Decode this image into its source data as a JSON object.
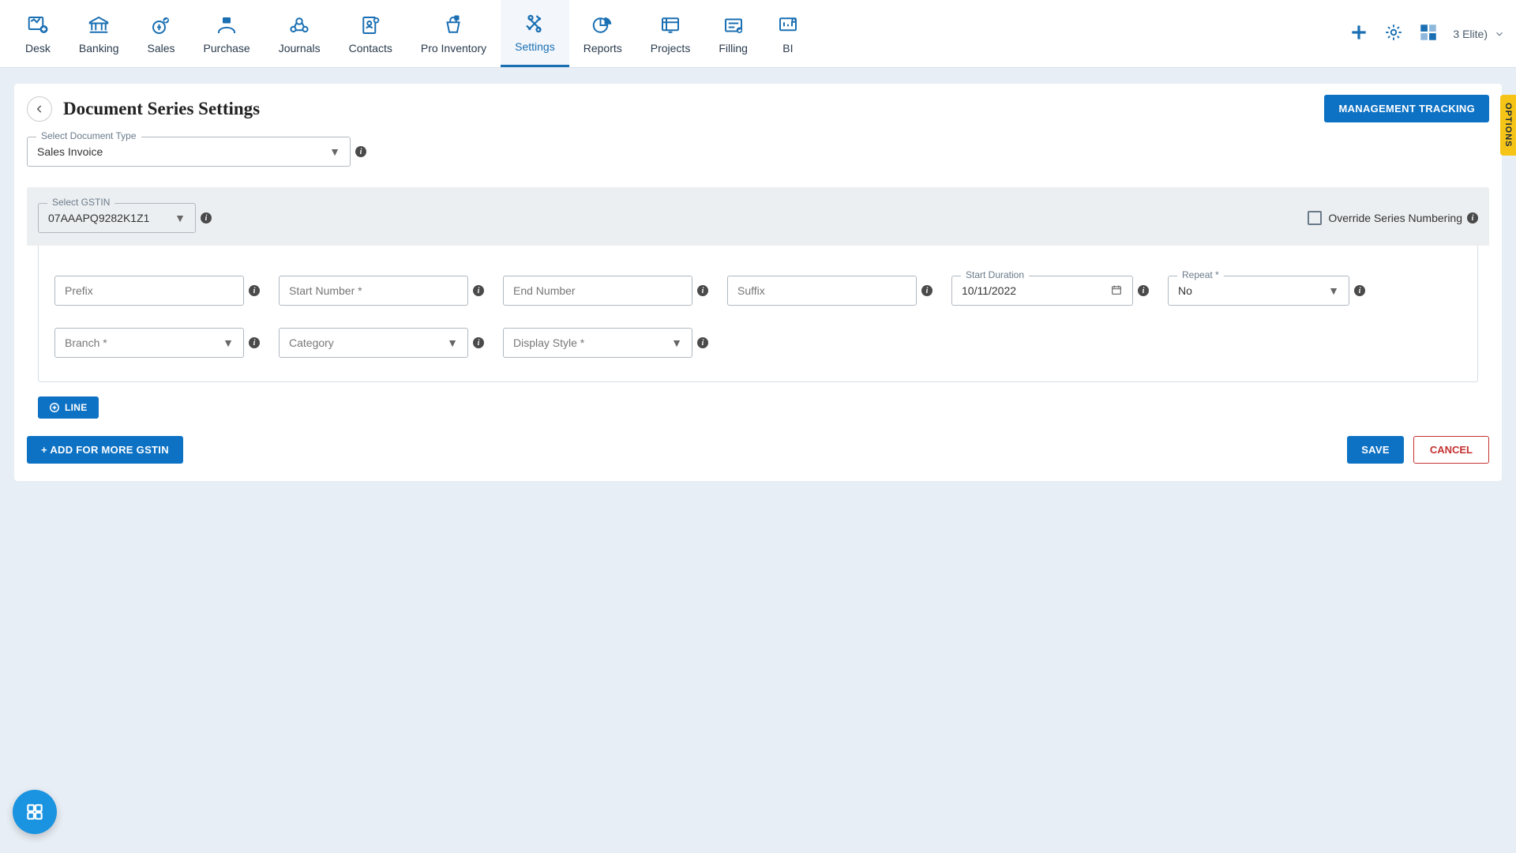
{
  "nav": {
    "items": [
      {
        "label": "Desk"
      },
      {
        "label": "Banking"
      },
      {
        "label": "Sales"
      },
      {
        "label": "Purchase"
      },
      {
        "label": "Journals"
      },
      {
        "label": "Contacts"
      },
      {
        "label": "Pro Inventory"
      },
      {
        "label": "Settings"
      },
      {
        "label": "Reports"
      },
      {
        "label": "Projects"
      },
      {
        "label": "Filling"
      },
      {
        "label": "BI"
      }
    ],
    "user_label": "3 Elite)"
  },
  "page": {
    "title": "Document Series Settings",
    "management_btn": "MANAGEMENT TRACKING",
    "options_tab": "OPTIONS"
  },
  "doc_type": {
    "label": "Select Document Type",
    "value": "Sales Invoice"
  },
  "gstin": {
    "label": "Select GSTIN",
    "value": "07AAAPQ9282K1Z1",
    "override_label": "Override Series Numbering"
  },
  "fields": {
    "prefix": {
      "label": "Prefix"
    },
    "start_number": {
      "label": "Start Number *"
    },
    "end_number": {
      "label": "End Number"
    },
    "suffix": {
      "label": "Suffix"
    },
    "start_duration": {
      "label": "Start Duration",
      "value": "10/11/2022"
    },
    "repeat": {
      "label": "Repeat *",
      "value": "No"
    },
    "branch": {
      "label": "Branch *"
    },
    "category": {
      "label": "Category"
    },
    "display_style": {
      "label": "Display Style *"
    }
  },
  "buttons": {
    "line": "LINE",
    "add_gstin": "+ ADD FOR MORE GSTIN",
    "save": "SAVE",
    "cancel": "CANCEL"
  }
}
